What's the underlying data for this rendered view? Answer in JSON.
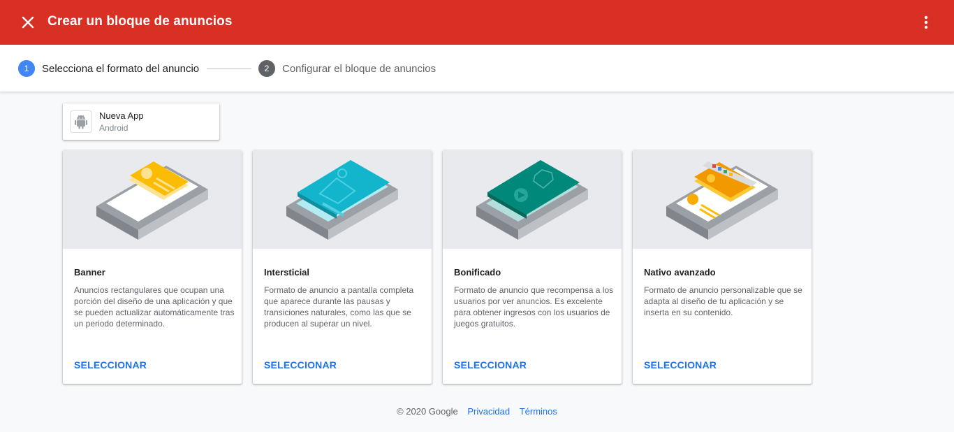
{
  "header": {
    "title": "Crear un bloque de anuncios",
    "bg_color": "#d93025"
  },
  "stepper": {
    "steps": [
      {
        "number": "1",
        "label": "Selecciona el formato del anuncio",
        "active": true
      },
      {
        "number": "2",
        "label": "Configurar el bloque de anuncios",
        "active": false
      }
    ]
  },
  "app": {
    "name": "Nueva App",
    "platform": "Android",
    "icon": "android-icon"
  },
  "formats": [
    {
      "title": "Banner",
      "description": "Anuncios rectangulares que ocupan una porción del diseño de una aplicación y que se pueden actualizar automáticamente tras un periodo determinado.",
      "action": "SELECCIONAR"
    },
    {
      "title": "Intersticial",
      "description": "Formato de anuncio a pantalla completa que aparece durante las pausas y transiciones naturales, como las que se producen al superar un nivel.",
      "action": "SELECCIONAR"
    },
    {
      "title": "Bonificado",
      "description": "Formato de anuncio que recompensa a los usuarios por ver anuncios. Es excelente para obtener ingresos con los usuarios de juegos gratuitos.",
      "action": "SELECCIONAR"
    },
    {
      "title": "Nativo avanzado",
      "description": "Formato de anuncio personalizable que se adapta al diseño de tu aplicación y se inserta en su contenido.",
      "action": "SELECCIONAR"
    }
  ],
  "footer": {
    "copyright": "© 2020 Google",
    "privacy": "Privacidad",
    "terms": "Términos"
  },
  "colors": {
    "accent": "#1a73e8",
    "banner": "#fbbc04",
    "interstitial": "#12b5cb",
    "rewarded": "#00897b",
    "native": "#f29900"
  }
}
